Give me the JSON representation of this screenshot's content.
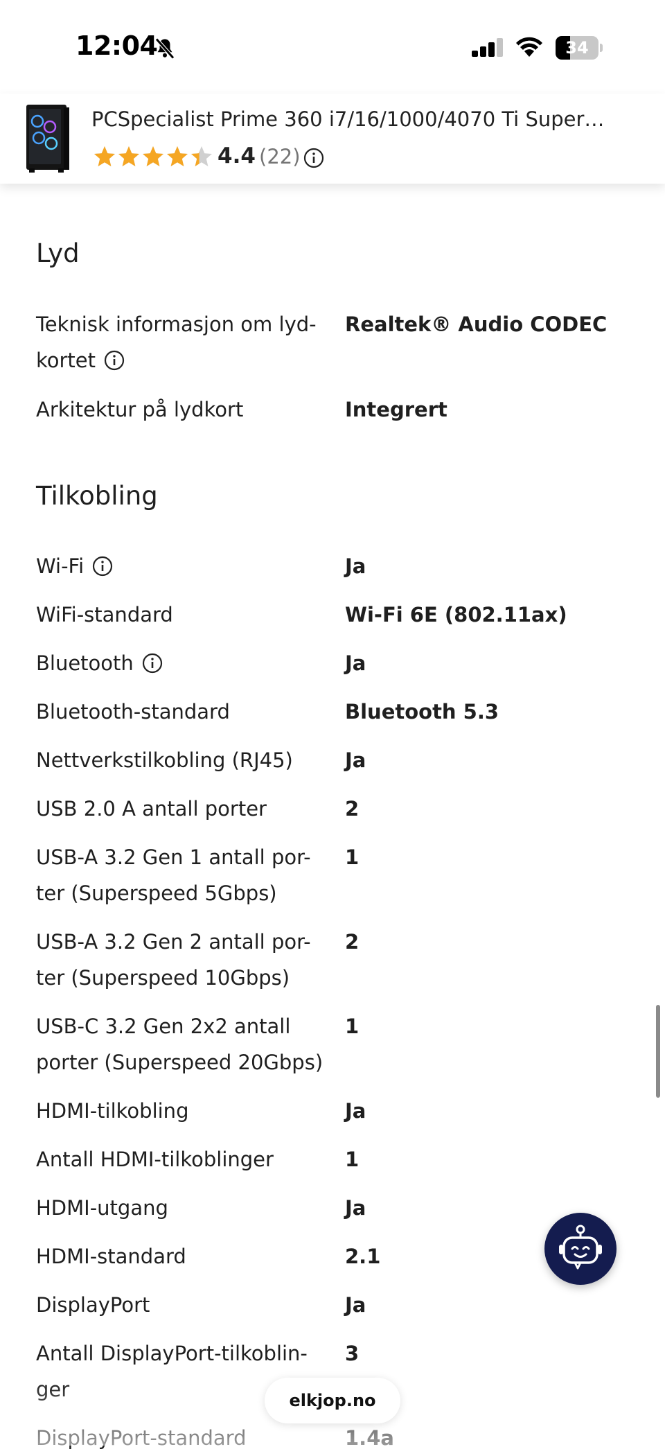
{
  "status_bar": {
    "time": "12:04",
    "battery_level": "34",
    "battery_fraction": 0.34
  },
  "product": {
    "title": "PCSpecialist Prime 360 i7/16/1000/4070 Ti Super…",
    "rating_value": "4.4",
    "rating_stars_fraction": 0.88,
    "rating_count": "(22)",
    "star_color": "#f5a623"
  },
  "sections": {
    "sound": {
      "title": "Lyd",
      "rows": [
        {
          "label": "Teknisk informasjon om lyd-kortet",
          "value": "Realtek® Audio CODEC"
        },
        {
          "label": "Arkitektur på lydkort",
          "value": "Integrert"
        }
      ]
    },
    "connectivity": {
      "title": "Tilkobling",
      "rows": [
        {
          "label": "Wi-Fi",
          "value": "Ja"
        },
        {
          "label": "WiFi-standard",
          "value": "Wi-Fi 6E (802.11ax)"
        },
        {
          "label": "Bluetooth",
          "value": "Ja"
        },
        {
          "label": "Bluetooth-standard",
          "value": "Bluetooth 5.3"
        },
        {
          "label": "Nettverkstilkobling (RJ45)",
          "value": "Ja"
        },
        {
          "label": "USB 2.0 A antall porter",
          "value": "2"
        },
        {
          "label": "USB-A 3.2 Gen 1 antall por-ter (Superspeed 5Gbps)",
          "value": "1"
        },
        {
          "label": "USB-A 3.2 Gen 2 antall por-ter (Superspeed 10Gbps)",
          "value": "2"
        },
        {
          "label": "USB-C 3.2 Gen 2x2 antall porter (Superspeed 20Gbps)",
          "value": "1"
        },
        {
          "label": "HDMI-tilkobling",
          "value": "Ja"
        },
        {
          "label": "Antall HDMI-tilkoblinger",
          "value": "1"
        },
        {
          "label": "HDMI-utgang",
          "value": "Ja"
        },
        {
          "label": "HDMI-standard",
          "value": "2.1"
        },
        {
          "label": "DisplayPort",
          "value": "Ja"
        },
        {
          "label": "Antall DisplayPort-tilkoblin-ger",
          "value": "3"
        },
        {
          "label": "DisplayPort-standard",
          "value": "1.4a"
        }
      ]
    }
  },
  "browser": {
    "url": "elkjop.no"
  },
  "icons": {
    "bell": "bell-slash-icon",
    "signal": "cellular-signal-icon",
    "wifi": "wifi-icon",
    "battery": "battery-icon",
    "info": "info-icon",
    "star": "star-icon",
    "chat": "chat-bot-icon"
  },
  "colors": {
    "chat_bot_bg": "#141c4f",
    "text": "#1f1f1f"
  }
}
